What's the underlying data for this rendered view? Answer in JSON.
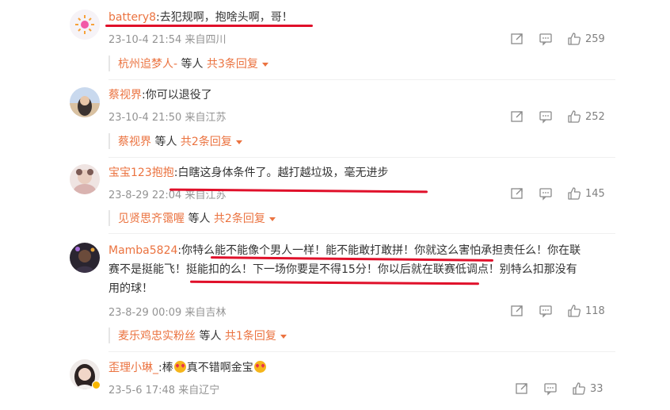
{
  "comments": [
    {
      "username": "battery8",
      "text": "去犯规啊，抱啥头啊，哥！",
      "meta": "23-10-4 21:54 来自四川",
      "likes": "259",
      "replies": {
        "user": "杭州追梦人-",
        "mid": " 等人 ",
        "more": "共3条回复"
      }
    },
    {
      "username": "蔡视界",
      "text": "你可以退役了",
      "meta": "23-10-4 21:50 来自江苏",
      "likes": "252",
      "replies": {
        "user": "蔡视界",
        "mid": " 等人 ",
        "more": "共2条回复"
      }
    },
    {
      "username": "宝宝123抱抱",
      "text": "白瞎这身体条件了。越打越垃圾，毫无进步",
      "meta": "23-8-29 22:04 来自江苏",
      "likes": "145",
      "replies": {
        "user": "见贤思齐霭喔",
        "mid": " 等人 ",
        "more": "共2条回复"
      }
    },
    {
      "username": "Mamba5824",
      "text_line1": "你特么能不能像个男人一样！能不能敢打敢拼！你就这么害怕承担责任么！你在联",
      "text_line2": "赛不是挺能飞！挺能扣的么！下一场你要是不得15分！你以后就在联赛低调点！别特么扣那没有",
      "text_line3": "用的球！",
      "meta": "23-8-29 00:09 来自吉林",
      "likes": "118",
      "replies": {
        "user": "麦乐鸡忠实粉丝",
        "mid": " 等人 ",
        "more": "共1条回复"
      }
    },
    {
      "username": "歪理小琳_",
      "text_a": "棒",
      "text_b": "真不错啊金宝",
      "meta": "23-5-6 17:48 来自辽宁",
      "likes": "33"
    }
  ],
  "icons": {
    "share": "share-icon",
    "comment": "comment-icon",
    "like": "thumbs-up-icon",
    "expand": "caret-down-icon"
  },
  "colors": {
    "username": "#eb7340",
    "annotation": "#e0102a",
    "meta": "#939393"
  }
}
